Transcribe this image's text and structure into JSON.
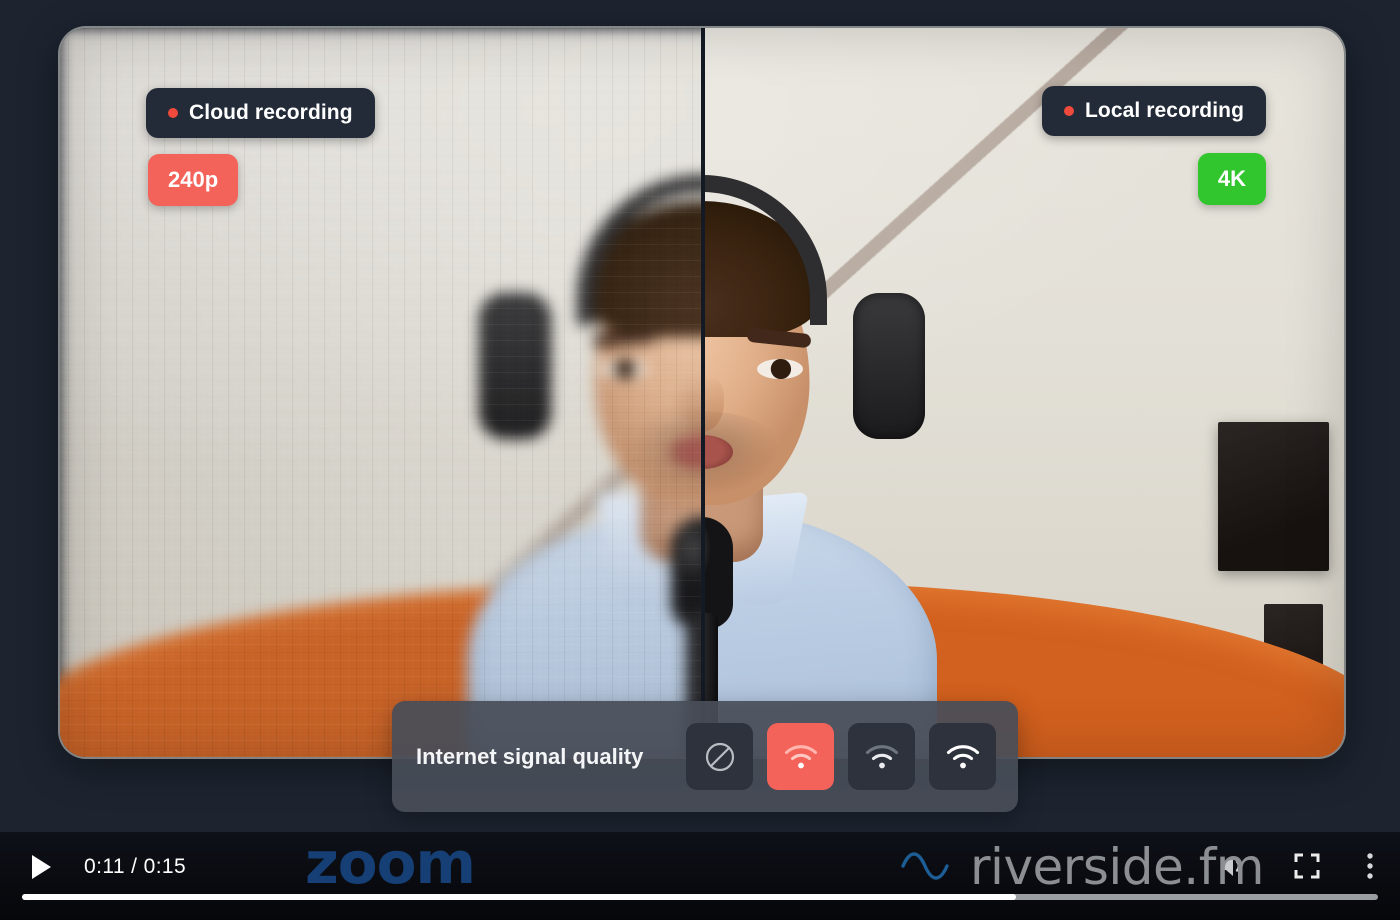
{
  "page": {
    "background_color": "#1d2430",
    "type": "video-player-screenshot"
  },
  "video": {
    "left_panel": {
      "recording_badge": {
        "label": "Cloud recording",
        "dot_color": "#f04a3c"
      },
      "quality_badge": {
        "label": "240p",
        "color": "#f4635a"
      },
      "render_style": "pixelated"
    },
    "right_panel": {
      "recording_badge": {
        "label": "Local recording",
        "dot_color": "#f04a3c"
      },
      "quality_badge": {
        "label": "4K",
        "color": "#31c52e"
      },
      "render_style": "sharp"
    }
  },
  "signal_panel": {
    "label": "Internet signal quality",
    "options": [
      {
        "name": "no-signal",
        "icon": "no-signal-icon",
        "active": false
      },
      {
        "name": "signal-weak",
        "icon": "wifi-weak-icon",
        "active": true
      },
      {
        "name": "signal-medium",
        "icon": "wifi-medium-icon",
        "active": false
      },
      {
        "name": "signal-strong",
        "icon": "wifi-strong-icon",
        "active": false
      }
    ],
    "active_color": "#f4635a",
    "button_color": "#2d323c"
  },
  "player": {
    "play_button_icon": "play-icon",
    "time_current": "0:11",
    "time_total": "0:15",
    "time_display": "0:11 / 0:15",
    "progress_percent": 73.3,
    "controls": [
      {
        "name": "volume",
        "icon": "volume-icon"
      },
      {
        "name": "fullscreen",
        "icon": "fullscreen-icon"
      },
      {
        "name": "more-options",
        "icon": "kebab-menu-icon"
      }
    ]
  },
  "branding": {
    "zoom_logo": "zoom",
    "zoom_color": "#17447e",
    "riverside_logo": "riverside.fm",
    "riverside_color": "#8b8e93"
  }
}
